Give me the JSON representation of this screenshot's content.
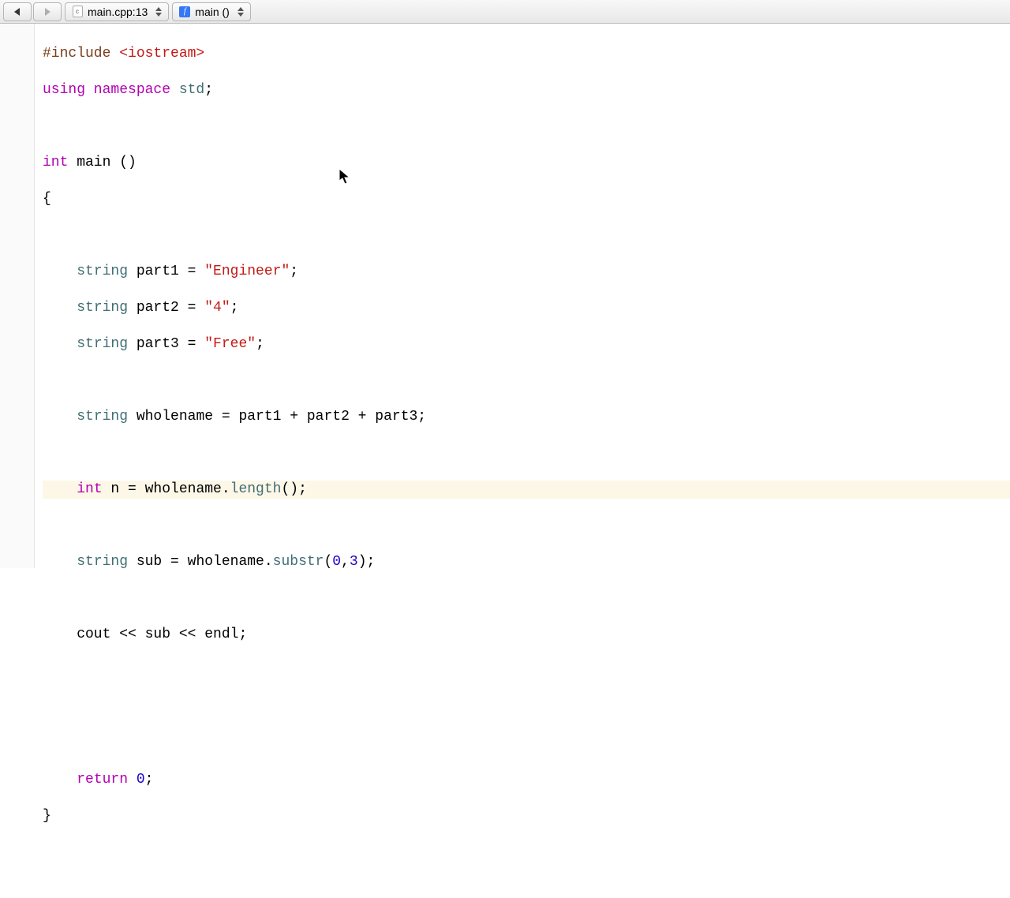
{
  "toolbar": {
    "file_crumb": "main.cpp:13",
    "func_crumb": "main ()"
  },
  "code": {
    "l1_include": "#include ",
    "l1_header": "<iostream>",
    "l2_using": "using namespace ",
    "l2_std": "std",
    "l2_semi": ";",
    "l3_int": "int",
    "l3_main": " main ()",
    "l4_brace": "{",
    "l5_empty": "",
    "l6_indent": "    ",
    "l6_string": "string",
    "l6_part": " part1 = ",
    "l6_val": "\"Engineer\"",
    "l6_semi": ";",
    "l7_string": "string",
    "l7_part": " part2 = ",
    "l7_val": "\"4\"",
    "l7_semi": ";",
    "l8_string": "string",
    "l8_part": " part3 = ",
    "l8_val": "\"Free\"",
    "l8_semi": ";",
    "l9_empty": "",
    "l10_string": "string",
    "l10_rest": " wholename = part1 + part2 + part3;",
    "l11_empty": "",
    "l12_int": "int",
    "l12_n": " n = wholename.",
    "l12_len": "length",
    "l12_paren": "();",
    "l13_empty": "",
    "l14_string": "string",
    "l14_sub": " sub = wholename.",
    "l14_substr": "substr",
    "l14_args_open": "(",
    "l14_arg0": "0",
    "l14_comma": ",",
    "l14_arg1": "3",
    "l14_args_close": ");",
    "l15_empty": "",
    "l16_cout": "    cout << sub << endl;",
    "l17_empty": "",
    "l18_empty": "",
    "l19_empty": "",
    "l20_return": "return",
    "l20_sp": " ",
    "l20_zero": "0",
    "l20_semi": ";",
    "l21_brace": "}"
  }
}
